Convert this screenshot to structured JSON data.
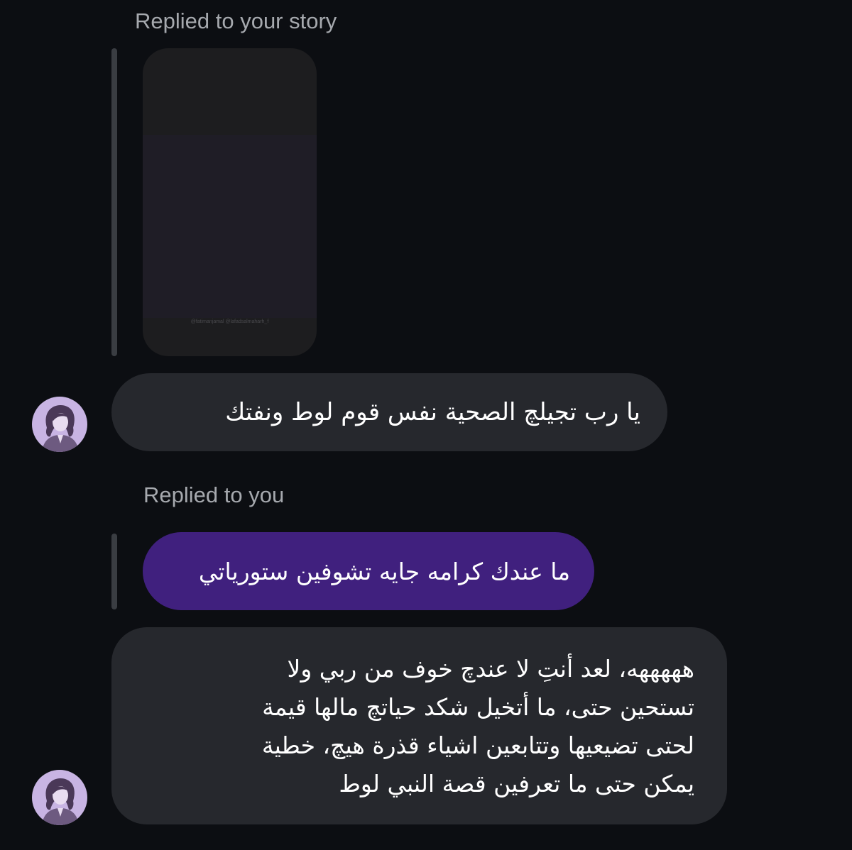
{
  "thread": {
    "story_reply": {
      "label": "Replied to your story",
      "watermark": "@fatimanjamal  @lafadsalmaharh_f"
    },
    "message_1": {
      "text": "يا رب تجيلچ الصحية نفس قوم لوط ونفتك"
    },
    "message_reply": {
      "label": "Replied to you",
      "quoted_text": "ما عندك كرامه جايه تشوفين ستورياتي"
    },
    "message_2": {
      "lines": [
        "هههههه، لعد أنتِ لا عندچ خوف من ربي ولا",
        "تستحين حتى، ما أتخيل شكد حياتچ مالها قيمة",
        "لحتى تضيعيها وتتابعين اشياء قذرة هيچ، خطية",
        "يمكن حتى ما تعرفين قصة النبي لوط"
      ]
    }
  },
  "colors": {
    "background": "#0c0e12",
    "incoming_bubble": "#26282d",
    "quoted_bubble": "#40207e",
    "label": "#a6a9ae",
    "avatar": "#c8b4e3"
  }
}
